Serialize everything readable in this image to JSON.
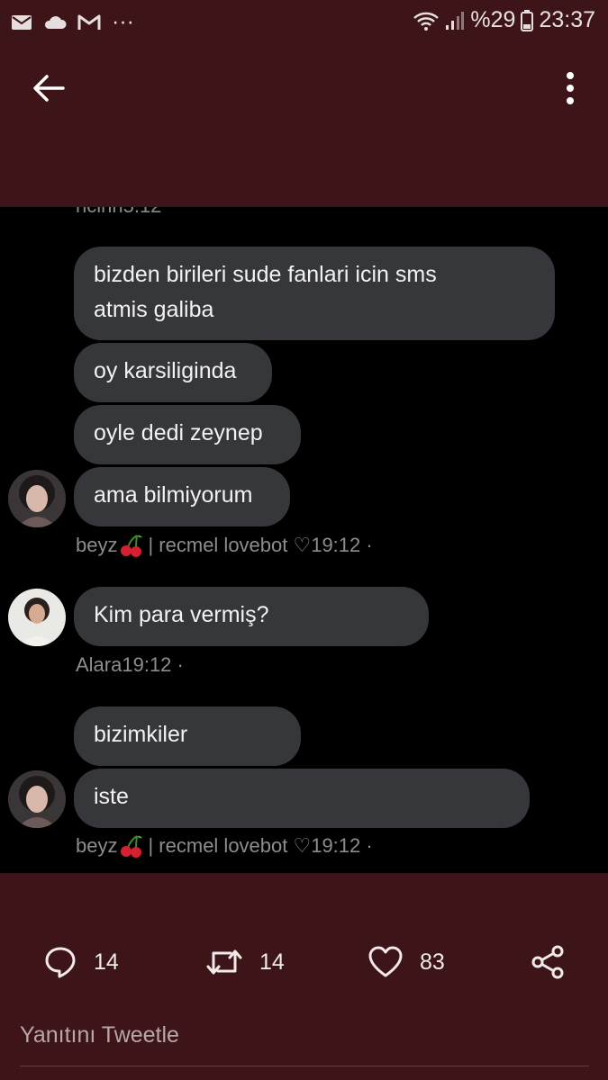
{
  "status_bar": {
    "battery_text": "%29",
    "time": "23:37",
    "left_icons": [
      "mail-icon",
      "cloud-icon",
      "gmail-icon",
      "more-dots-icon"
    ],
    "right_icons": [
      "wifi-icon",
      "signal-icon",
      "battery-icon"
    ]
  },
  "app_bar": {
    "back_icon": "arrow-left-icon",
    "menu_icon": "vertical-dots-icon"
  },
  "chat": {
    "cut_label": "ncinn5.12",
    "messages": [
      {
        "text": "bizden birileri sude fanlari icin sms\natmis galiba"
      },
      {
        "text": "oy karsiliginda"
      },
      {
        "text": "oyle dedi zeynep"
      },
      {
        "text": "ama bilmiyorum"
      },
      {
        "text": "Kim para vermiş?"
      },
      {
        "text": "bizimkiler"
      },
      {
        "text": "iste"
      }
    ],
    "meta": [
      {
        "name": "beyz",
        "rest": "| recmel lovebot ♡19:12 ·"
      },
      {
        "name": "Alara19:12 ·",
        "rest": ""
      },
      {
        "name": "beyz",
        "rest": "| recmel lovebot ♡19:12 ·"
      }
    ]
  },
  "actions": {
    "reply_count": "14",
    "retweet_count": "14",
    "like_count": "83"
  },
  "reply_placeholder": "Yanıtını Tweetle",
  "colors": {
    "background": "#3d1417",
    "bubble": "#36373b",
    "chat_bg": "#000000"
  }
}
